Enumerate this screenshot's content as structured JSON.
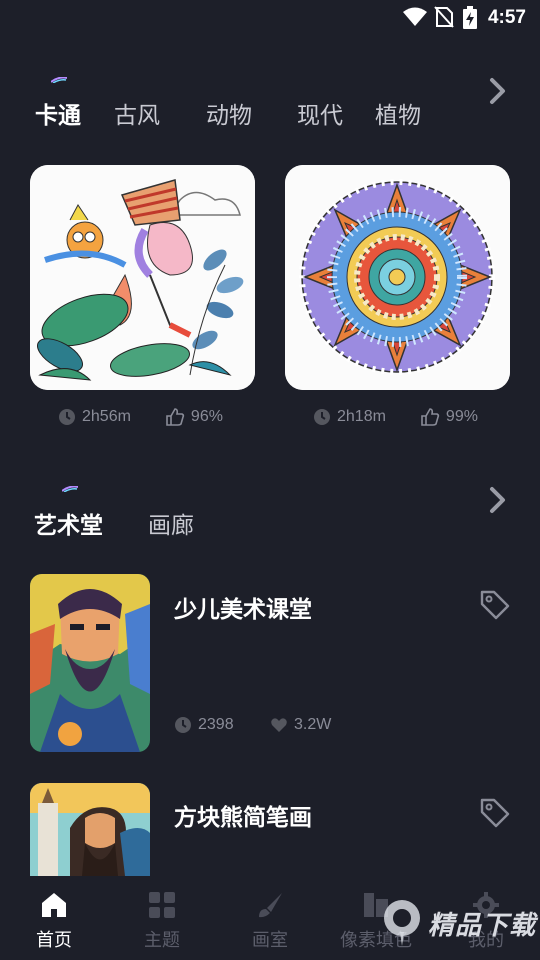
{
  "status": {
    "time": "4:57"
  },
  "categories": {
    "tabs": [
      "卡通",
      "古风",
      "动物",
      "现代",
      "植物"
    ],
    "active_index": 0
  },
  "cards": [
    {
      "duration": "2h56m",
      "likes": "96%"
    },
    {
      "duration": "2h18m",
      "likes": "99%"
    }
  ],
  "section": {
    "tabs": [
      "艺术堂",
      "画廊"
    ],
    "active_index": 0
  },
  "items": [
    {
      "title": "少儿美术课堂",
      "views": "2398",
      "likes": "3.2W"
    },
    {
      "title": "方块熊简笔画"
    }
  ],
  "nav": {
    "items": [
      {
        "label": "首页",
        "icon": "home-icon",
        "active": true
      },
      {
        "label": "主题",
        "icon": "grid-icon"
      },
      {
        "label": "画室",
        "icon": "brush-icon"
      },
      {
        "label": "像素填色",
        "icon": "pixel-icon"
      },
      {
        "label": "我的",
        "icon": "gear-icon"
      }
    ]
  },
  "watermark": {
    "text": "精品下载"
  },
  "colors": {
    "background": "#1d1f29",
    "muted": "#8a8c98",
    "active_text": "#ffffff"
  }
}
